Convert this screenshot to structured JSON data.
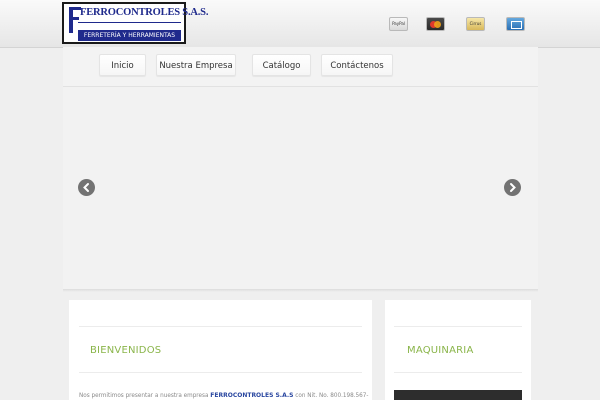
{
  "header": {
    "logo": {
      "name": "FERROCONTROLES S.A.S.",
      "tagline": "FERRETERÍA Y HERRAMIENTAS"
    },
    "payment_icons": [
      {
        "name": "paypal-icon",
        "label": "PayPal"
      },
      {
        "name": "mastercard-icon",
        "label": "MasterCard"
      },
      {
        "name": "cirrus-icon",
        "label": "Cirrus"
      },
      {
        "name": "amex-icon",
        "label": "American Express"
      }
    ]
  },
  "nav": {
    "items": [
      {
        "label": "Inicio"
      },
      {
        "label": "Nuestra Empresa"
      },
      {
        "label": "Catálogo"
      },
      {
        "label": "Contáctenos"
      }
    ]
  },
  "slider": {
    "prev_icon": "chevron-left-icon",
    "next_icon": "chevron-right-icon",
    "dots": 4
  },
  "welcome": {
    "title": "BIENVENIDOS",
    "intro_before": "Nos permitimos presentar a nuestra empresa",
    "company": "FERROCONTROLES S.A.S",
    "intro_after": "con Nit. No. 800.198.567-"
  },
  "machinery": {
    "title": "MAQUINARIA"
  },
  "colors": {
    "accent_green": "#8ab54a",
    "brand_blue": "#1f2a8c",
    "arrow_gray": "#737373"
  }
}
